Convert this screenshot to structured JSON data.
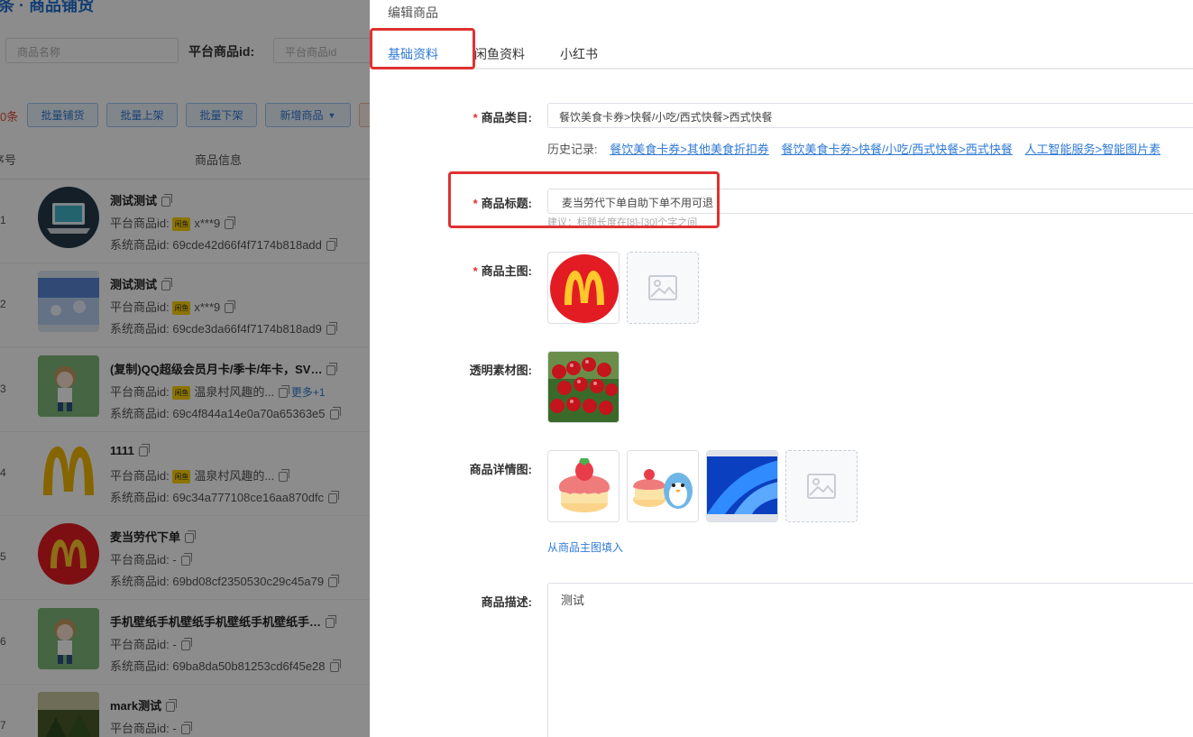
{
  "background": {
    "page_title": "条 · 商品铺货",
    "filters": {
      "name_placeholder": "商品名称",
      "platform_id_label": "平台商品id:",
      "platform_id_placeholder": "平台商品id"
    },
    "count_text": "0条",
    "batch_buttons": [
      "批量铺货",
      "批量上架",
      "批量下架",
      "新增商品"
    ],
    "columns": {
      "index": "序号",
      "info": "商品信息"
    },
    "field_platform": "平台商品id:",
    "field_system": "系统商品id:",
    "xianyu_badge": "闲鱼",
    "more_label": "更多+1",
    "rows": [
      {
        "idx": "1",
        "name": "测试测试",
        "platform": "x***9",
        "has_badge": true,
        "system": "69cde42d66f4f7174b818add",
        "thumb": "laptop"
      },
      {
        "idx": "2",
        "name": "测试测试",
        "platform": "x***9",
        "has_badge": true,
        "system": "69cde3da66f4f7174b818ad9",
        "thumb": "blue"
      },
      {
        "idx": "3",
        "name": "(复制)QQ超级会员月卡/季卡/年卡，SV…",
        "platform": "温泉村风趣的...",
        "has_badge": true,
        "has_more": true,
        "system": "69c4f844a14e0a70a65363e5",
        "thumb": "girl"
      },
      {
        "idx": "4",
        "name": "1111",
        "platform": "温泉村风趣的...",
        "has_badge": true,
        "system": "69c34a777108ce16aa870dfc",
        "thumb": "mlogo"
      },
      {
        "idx": "5",
        "name": "麦当劳代下单",
        "platform": "-",
        "has_badge": false,
        "system": "69bd08cf2350530c29c45a79",
        "thumb": "mcircle"
      },
      {
        "idx": "6",
        "name": "手机壁纸手机壁纸手机壁纸手机壁纸手…",
        "platform": "-",
        "has_badge": false,
        "system": "69ba8da50b81253cd6f45e28",
        "thumb": "girl"
      },
      {
        "idx": "7",
        "name": "mark测试",
        "platform": "-",
        "has_badge": false,
        "system": "",
        "thumb": "forest"
      }
    ]
  },
  "drawer": {
    "title": "编辑商品",
    "tabs": [
      "基础资料",
      "闲鱼资料",
      "小红书"
    ],
    "active_tab": "基础资料",
    "category_label": "商品类目:",
    "category_value": "餐饮美食卡券>快餐/小吃/西式快餐>西式快餐",
    "history_label": "历史记录:",
    "history_links": [
      "餐饮美食卡券>其他美食折扣券",
      "餐饮美食卡券>快餐/小吃/西式快餐>西式快餐",
      "人工智能服务>智能图片素"
    ],
    "title_label": "商品标题:",
    "title_value": "麦当劳代下单自助下单不用可退",
    "title_hint": "建议：标题长度在[8]-[30]个字之间",
    "main_image_label": "商品主图:",
    "transparent_label": "透明素材图:",
    "detail_label": "商品详情图:",
    "fill_from_main": "从商品主图填入",
    "desc_label": "商品描述:",
    "desc_value": "测试"
  },
  "colors": {
    "accent": "#2f7ad6",
    "highlight": "#e03131",
    "required": "#e03131"
  }
}
